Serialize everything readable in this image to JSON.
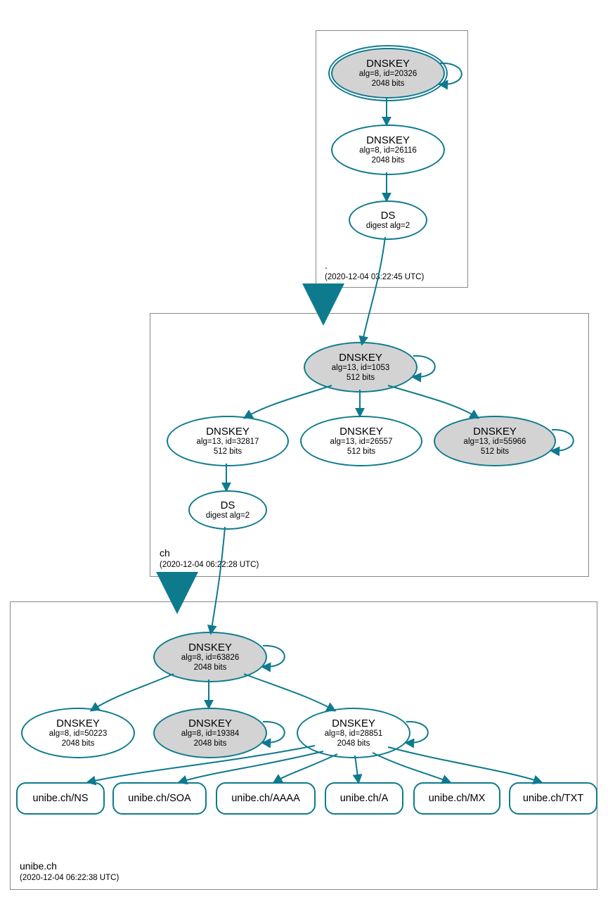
{
  "zones": {
    "root": {
      "label": ".",
      "ts": "(2020-12-04 03:22:45 UTC)"
    },
    "ch": {
      "label": "ch",
      "ts": "(2020-12-04 06:22:28 UTC)"
    },
    "unibe": {
      "label": "unibe.ch",
      "ts": "(2020-12-04 06:22:38 UTC)"
    }
  },
  "nodes": {
    "root_ksk": {
      "t": "DNSKEY",
      "l1": "alg=8, id=20326",
      "l2": "2048 bits"
    },
    "root_zsk": {
      "t": "DNSKEY",
      "l1": "alg=8, id=26116",
      "l2": "2048 bits"
    },
    "root_ds": {
      "t": "DS",
      "l1": "digest alg=2"
    },
    "ch_ksk": {
      "t": "DNSKEY",
      "l1": "alg=13, id=1053",
      "l2": "512 bits"
    },
    "ch_z1": {
      "t": "DNSKEY",
      "l1": "alg=13, id=32817",
      "l2": "512 bits"
    },
    "ch_z2": {
      "t": "DNSKEY",
      "l1": "alg=13, id=26557",
      "l2": "512 bits"
    },
    "ch_z3": {
      "t": "DNSKEY",
      "l1": "alg=13, id=55966",
      "l2": "512 bits"
    },
    "ch_ds": {
      "t": "DS",
      "l1": "digest alg=2"
    },
    "u_ksk": {
      "t": "DNSKEY",
      "l1": "alg=8, id=63826",
      "l2": "2048 bits"
    },
    "u_z1": {
      "t": "DNSKEY",
      "l1": "alg=8, id=50223",
      "l2": "2048 bits"
    },
    "u_z2": {
      "t": "DNSKEY",
      "l1": "alg=8, id=19384",
      "l2": "2048 bits"
    },
    "u_z3": {
      "t": "DNSKEY",
      "l1": "alg=8, id=28851",
      "l2": "2048 bits"
    }
  },
  "rr": {
    "ns": "unibe.ch/NS",
    "soa": "unibe.ch/SOA",
    "aaaa": "unibe.ch/AAAA",
    "a": "unibe.ch/A",
    "mx": "unibe.ch/MX",
    "txt": "unibe.ch/TXT"
  }
}
